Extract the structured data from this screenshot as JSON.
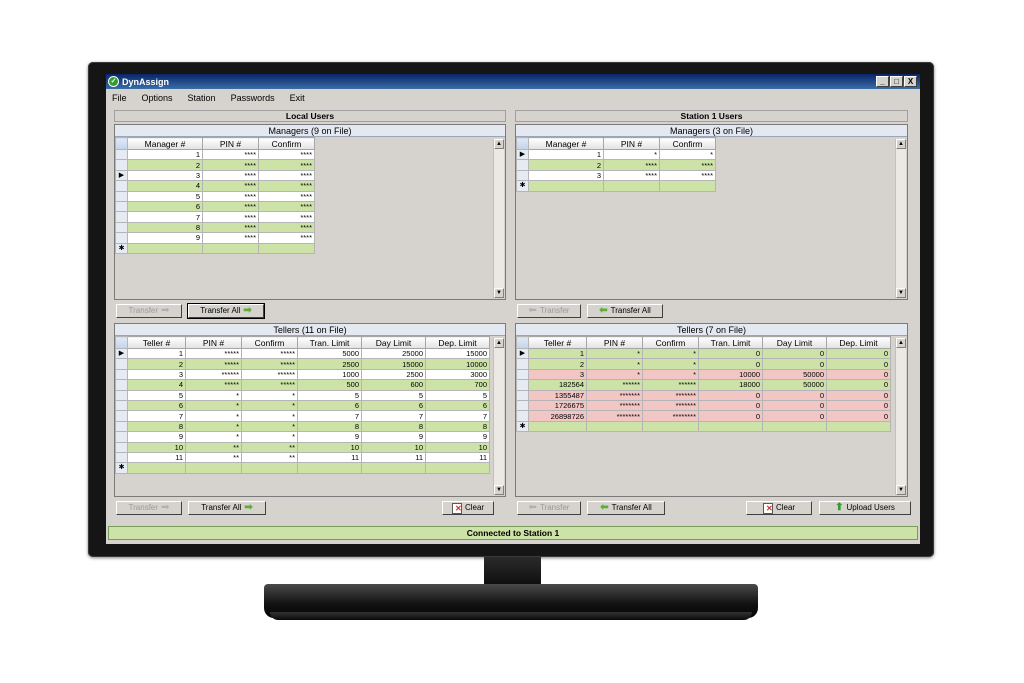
{
  "window": {
    "title": "DynAssign",
    "controls": [
      "_",
      "□",
      "X"
    ]
  },
  "menu": [
    "File",
    "Options",
    "Station",
    "Passwords",
    "Exit"
  ],
  "local": {
    "header": "Local Users",
    "managers": {
      "caption": "Managers (9 on File)",
      "columns": [
        "Manager #",
        "PIN #",
        "Confirm"
      ],
      "rows": [
        {
          "id": "1",
          "pin": "****",
          "confirm": "****",
          "color": "white"
        },
        {
          "id": "2",
          "pin": "****",
          "confirm": "****",
          "color": "green"
        },
        {
          "id": "3",
          "pin": "****",
          "confirm": "****",
          "color": "white"
        },
        {
          "id": "4",
          "pin": "****",
          "confirm": "****",
          "color": "green"
        },
        {
          "id": "5",
          "pin": "****",
          "confirm": "****",
          "color": "white"
        },
        {
          "id": "6",
          "pin": "****",
          "confirm": "****",
          "color": "green"
        },
        {
          "id": "7",
          "pin": "****",
          "confirm": "****",
          "color": "white"
        },
        {
          "id": "8",
          "pin": "****",
          "confirm": "****",
          "color": "green"
        },
        {
          "id": "9",
          "pin": "****",
          "confirm": "****",
          "color": "white"
        }
      ],
      "current_row": 2
    },
    "manager_buttons": {
      "transfer": "Transfer",
      "transfer_all": "Transfer All"
    },
    "tellers": {
      "caption": "Tellers (11 on File)",
      "columns": [
        "Teller #",
        "PIN #",
        "Confirm",
        "Tran. Limit",
        "Day Limit",
        "Dep. Limit"
      ],
      "rows": [
        {
          "id": "1",
          "pin": "*****",
          "confirm": "*****",
          "tran": "5000",
          "day": "25000",
          "dep": "15000",
          "color": "white"
        },
        {
          "id": "2",
          "pin": "*****",
          "confirm": "*****",
          "tran": "2500",
          "day": "15000",
          "dep": "10000",
          "color": "green"
        },
        {
          "id": "3",
          "pin": "******",
          "confirm": "******",
          "tran": "1000",
          "day": "2500",
          "dep": "3000",
          "color": "white"
        },
        {
          "id": "4",
          "pin": "*****",
          "confirm": "*****",
          "tran": "500",
          "day": "600",
          "dep": "700",
          "color": "green"
        },
        {
          "id": "5",
          "pin": "*",
          "confirm": "*",
          "tran": "5",
          "day": "5",
          "dep": "5",
          "color": "white"
        },
        {
          "id": "6",
          "pin": "*",
          "confirm": "*",
          "tran": "6",
          "day": "6",
          "dep": "6",
          "color": "green"
        },
        {
          "id": "7",
          "pin": "*",
          "confirm": "*",
          "tran": "7",
          "day": "7",
          "dep": "7",
          "color": "white"
        },
        {
          "id": "8",
          "pin": "*",
          "confirm": "*",
          "tran": "8",
          "day": "8",
          "dep": "8",
          "color": "green"
        },
        {
          "id": "9",
          "pin": "*",
          "confirm": "*",
          "tran": "9",
          "day": "9",
          "dep": "9",
          "color": "white"
        },
        {
          "id": "10",
          "pin": "**",
          "confirm": "**",
          "tran": "10",
          "day": "10",
          "dep": "10",
          "color": "green"
        },
        {
          "id": "11",
          "pin": "**",
          "confirm": "**",
          "tran": "11",
          "day": "11",
          "dep": "11",
          "color": "white"
        }
      ],
      "current_row": 0
    },
    "teller_buttons": {
      "transfer": "Transfer",
      "transfer_all": "Transfer All",
      "clear": "Clear"
    }
  },
  "station": {
    "header": "Station 1 Users",
    "managers": {
      "caption": "Managers (3 on File)",
      "columns": [
        "Manager #",
        "PIN #",
        "Confirm"
      ],
      "rows": [
        {
          "id": "1",
          "pin": "*",
          "confirm": "*",
          "color": "white"
        },
        {
          "id": "2",
          "pin": "****",
          "confirm": "****",
          "color": "green"
        },
        {
          "id": "3",
          "pin": "****",
          "confirm": "****",
          "color": "white"
        }
      ],
      "current_row": 0
    },
    "manager_buttons": {
      "transfer": "Transfer",
      "transfer_all": "Transfer All"
    },
    "tellers": {
      "caption": "Tellers (7 on File)",
      "columns": [
        "Teller #",
        "PIN #",
        "Confirm",
        "Tran. Limit",
        "Day Limit",
        "Dep. Limit"
      ],
      "rows": [
        {
          "id": "1",
          "pin": "*",
          "confirm": "*",
          "tran": "0",
          "day": "0",
          "dep": "0",
          "color": "green"
        },
        {
          "id": "2",
          "pin": "*",
          "confirm": "*",
          "tran": "0",
          "day": "0",
          "dep": "0",
          "color": "green"
        },
        {
          "id": "3",
          "pin": "*",
          "confirm": "*",
          "tran": "10000",
          "day": "50000",
          "dep": "0",
          "color": "pink"
        },
        {
          "id": "182564",
          "pin": "******",
          "confirm": "******",
          "tran": "18000",
          "day": "50000",
          "dep": "0",
          "color": "green"
        },
        {
          "id": "1355487",
          "pin": "*******",
          "confirm": "*******",
          "tran": "0",
          "day": "0",
          "dep": "0",
          "color": "pink"
        },
        {
          "id": "1726675",
          "pin": "*******",
          "confirm": "*******",
          "tran": "0",
          "day": "0",
          "dep": "0",
          "color": "pink"
        },
        {
          "id": "26898726",
          "pin": "********",
          "confirm": "********",
          "tran": "0",
          "day": "0",
          "dep": "0",
          "color": "pink"
        }
      ],
      "current_row": 0
    },
    "teller_buttons": {
      "transfer": "Transfer",
      "transfer_all": "Transfer All",
      "clear": "Clear",
      "upload": "Upload Users"
    }
  },
  "status": "Connected to Station 1",
  "colors": {
    "row_green": "#cce2a6",
    "row_pink": "#f3c6c6",
    "row_white": "#ffffff",
    "status_bg": "#cce2a6"
  }
}
